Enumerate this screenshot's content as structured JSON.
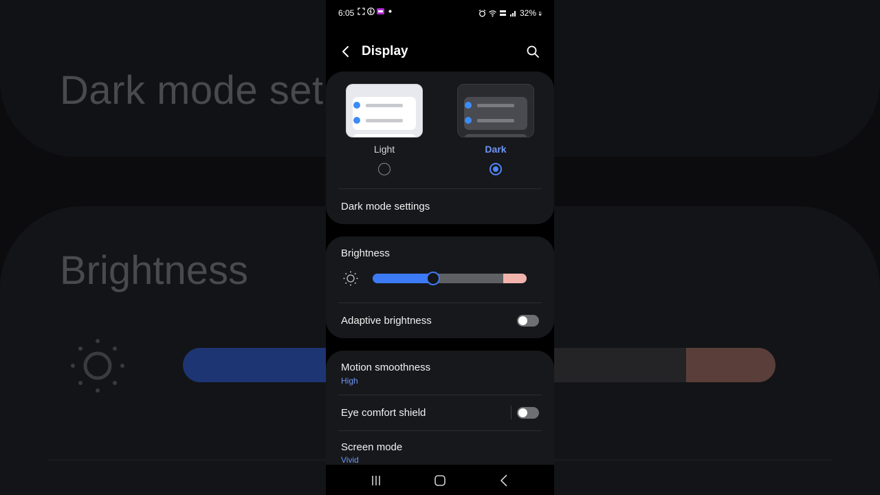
{
  "background": {
    "heading1": "Dark mode set",
    "heading2": "Brightness"
  },
  "status_bar": {
    "time": "6:05",
    "battery": "32%"
  },
  "appbar": {
    "title": "Display",
    "back_icon": "chevron-left-icon",
    "search_icon": "search-icon"
  },
  "theme": {
    "options": [
      {
        "label": "Light",
        "selected": false
      },
      {
        "label": "Dark",
        "selected": true
      }
    ],
    "dark_mode_settings_label": "Dark mode settings"
  },
  "brightness": {
    "label": "Brightness",
    "level_fraction": 0.39,
    "adaptive_label": "Adaptive brightness",
    "adaptive_on": false
  },
  "display_settings": {
    "motion_smoothness_label": "Motion smoothness",
    "motion_smoothness_value": "High",
    "eye_comfort_label": "Eye comfort shield",
    "eye_comfort_on": false,
    "screen_mode_label": "Screen mode",
    "screen_mode_value": "Vivid"
  },
  "navigation": {
    "recents_icon": "recents-icon",
    "home_icon": "home-icon",
    "back_icon": "back-icon"
  },
  "colors": {
    "accent": "#3d7af6",
    "card": "#17181c",
    "sub_text": "#6e96f5"
  }
}
